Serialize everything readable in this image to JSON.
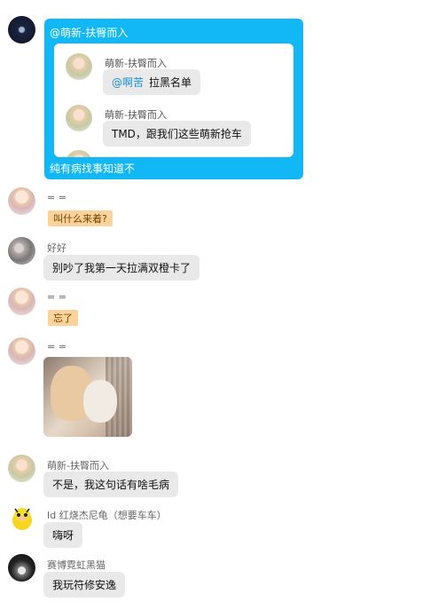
{
  "forward_card": {
    "mention": "@萌新-扶臀而入",
    "messages": [
      {
        "nick": "萌新-扶臀而入",
        "mention": "@啊苦",
        "text": "拉黑名单"
      },
      {
        "nick": "萌新-扶臀而入",
        "text": "TMD，跟我们这些萌新抢车"
      }
    ],
    "footer": "纯有病找事知道不"
  },
  "messages": [
    {
      "nick": "= =",
      "tag": "叫什么来着?"
    },
    {
      "nick": "好好",
      "text": "别吵了我第一天拉满双橙卡了"
    },
    {
      "nick": "= =",
      "tag": "忘了"
    },
    {
      "nick": "= =",
      "image": "cats-photo"
    },
    {
      "nick": "萌新-扶臀而入",
      "text": "不是，我这句话有啥毛病"
    },
    {
      "nick": "Id 红烧杰尼龟（想要车车）",
      "text": "嗨呀"
    },
    {
      "nick": "赛博霓虹黑猫",
      "text": "我玩符修安逸"
    }
  ]
}
